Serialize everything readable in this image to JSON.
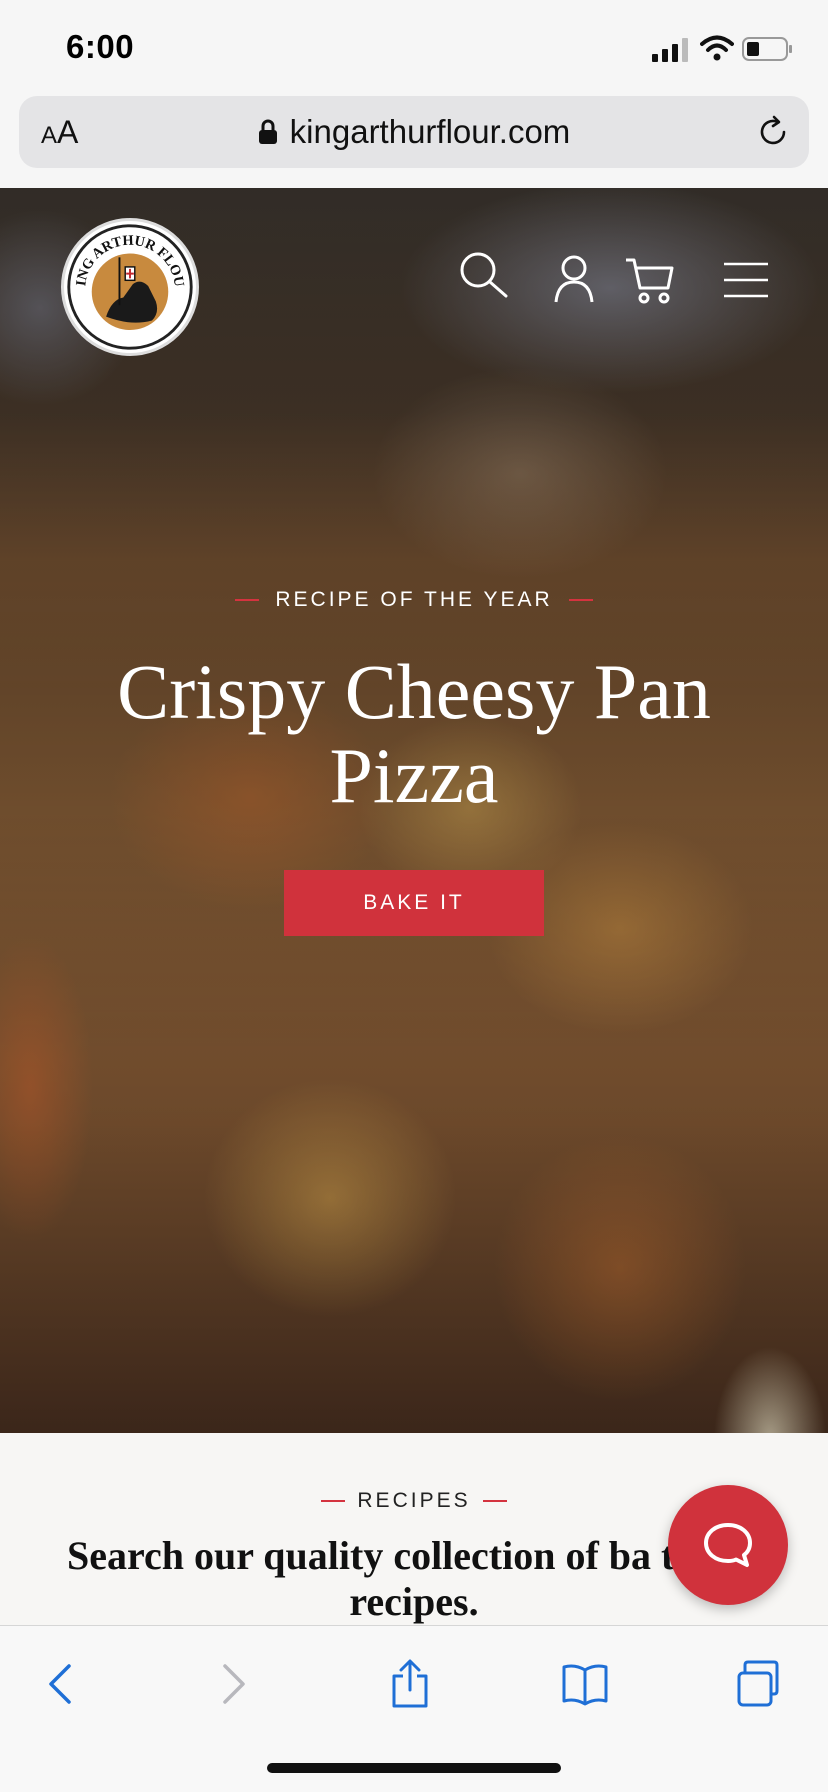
{
  "status_bar": {
    "time": "6:00"
  },
  "browser": {
    "text_size_small": "A",
    "text_size_big": "A",
    "url": "kingarthurflour.com"
  },
  "site": {
    "logo_text": "KING ARTHUR FLOUR"
  },
  "hero": {
    "eyebrow": "RECIPE OF THE YEAR",
    "title": "Crispy Cheesy Pan Pizza",
    "button": "BAKE IT"
  },
  "recipes": {
    "eyebrow": "RECIPES",
    "heading": "Search our quality collection of ba tested recipes."
  },
  "colors": {
    "brand_red": "#d0323c",
    "ios_blue": "#1f6fd6"
  },
  "icons": {
    "header": [
      "search-icon",
      "account-icon",
      "cart-icon",
      "menu-icon"
    ],
    "toolbar": [
      "back-icon",
      "forward-icon",
      "share-icon",
      "bookmarks-icon",
      "tabs-icon"
    ],
    "chat": "chat-icon"
  }
}
